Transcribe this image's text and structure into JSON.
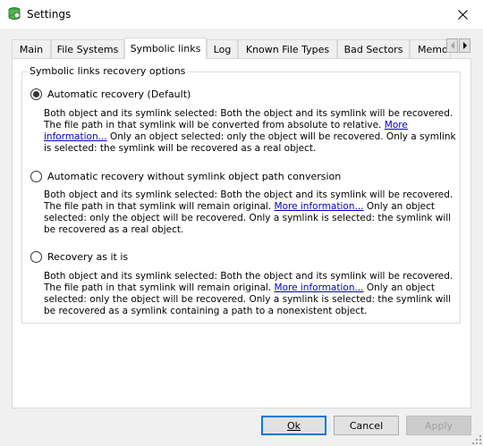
{
  "window": {
    "title": "Settings"
  },
  "tabs": [
    {
      "label": "Main"
    },
    {
      "label": "File Systems"
    },
    {
      "label": "Symbolic links"
    },
    {
      "label": "Log"
    },
    {
      "label": "Known File Types"
    },
    {
      "label": "Bad Sectors"
    },
    {
      "label": "Memo"
    }
  ],
  "group": {
    "legend": "Symbolic links recovery options",
    "options": [
      {
        "label": "Automatic recovery (Default)",
        "selected": true,
        "desc_before": "Both object and its symlink selected: Both the object and its symlink will be recovered. The file path in that symlink will be converted from absolute to relative. ",
        "link": "More information...",
        "desc_after": " Only an object selected: only the object will be recovered. Only a symlink is selected: the symlink will be recovered as a real object."
      },
      {
        "label": "Automatic recovery without symlink object path conversion",
        "selected": false,
        "desc_before": "Both object and its symlink selected: Both the object and its symlink will be recovered. The file path in that symlink will remain original. ",
        "link": "More information...",
        "desc_after": " Only an object selected: only the object will be recovered. Only a symlink is selected: the symlink will be recovered as a real object."
      },
      {
        "label": "Recovery as it is",
        "selected": false,
        "desc_before": "Both object and its symlink selected: Both the object and its symlink will be recovered. The file path in that symlink will remain original. ",
        "link": "More information...",
        "desc_after": " Only an object selected: only the object will be recovered. Only a symlink is selected: the symlink will be recovered as a symlink containing a path to a nonexistent object."
      }
    ]
  },
  "buttons": {
    "ok": "Ok",
    "cancel": "Cancel",
    "apply": "Apply"
  },
  "colors": {
    "accent": "#0078d7",
    "link": "#0000cc"
  }
}
